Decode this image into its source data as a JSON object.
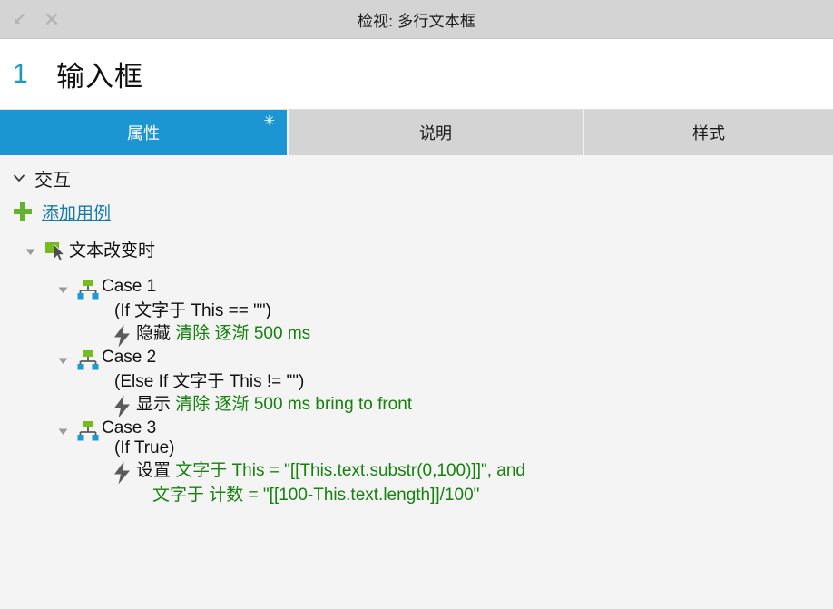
{
  "titlebar": {
    "title": "检视: 多行文本框",
    "buttons": [
      {
        "name": "collapse-icon",
        "label": "collapse"
      },
      {
        "name": "close-icon",
        "label": "close"
      }
    ]
  },
  "widget": {
    "index": "1",
    "name": "输入框"
  },
  "tabs": [
    {
      "label": "属性",
      "active": true,
      "badge": "✳"
    },
    {
      "label": "说明",
      "active": false,
      "badge": ""
    },
    {
      "label": "样式",
      "active": false,
      "badge": ""
    }
  ],
  "section": {
    "caret": "chevron-down",
    "title": "交互",
    "add_case_label": "添加用例"
  },
  "event": {
    "caret": "triangle-down",
    "icon": "mouse-cursor-icon",
    "label": "文本改变时"
  },
  "cases": [
    {
      "caret": "triangle-down",
      "icon": "case-branch-icon",
      "title": "Case 1",
      "condition": "(If 文字于 This == \"\")",
      "actions": [
        {
          "icon": "lightning-bolt-icon",
          "lines": [
            [
              {
                "text": "隐藏 ",
                "color": "black"
              },
              {
                "text": "清除 逐渐 500 ms",
                "color": "green"
              }
            ]
          ]
        }
      ]
    },
    {
      "caret": "triangle-down",
      "icon": "case-branch-icon",
      "title": "Case 2",
      "condition": "(Else If 文字于 This != \"\")",
      "actions": [
        {
          "icon": "lightning-bolt-icon",
          "lines": [
            [
              {
                "text": "显示 ",
                "color": "black"
              },
              {
                "text": "清除 逐渐 500 ms bring to front",
                "color": "green"
              }
            ]
          ]
        }
      ]
    },
    {
      "caret": "triangle-down",
      "icon": "case-branch-icon",
      "title": "Case 3",
      "condition": "(If True)",
      "actions": [
        {
          "icon": "lightning-bolt-icon",
          "lines": [
            [
              {
                "text": "设置 ",
                "color": "black"
              },
              {
                "text": "文字于 This = \"[[This.text.substr(0,100)]]\", and",
                "color": "green"
              }
            ],
            [
              {
                "text": "文字于 计数 = \"[[100-This.text.length]]/100\"",
                "color": "green"
              }
            ]
          ]
        }
      ]
    }
  ],
  "colors": {
    "tab_active": "#1b96d3",
    "link": "#1679a8",
    "green_text": "#17800f",
    "green_icon": "#76bc21",
    "blue_icon": "#1b9ad6",
    "index_blue": "#2196c4",
    "titlebar_bg": "#d4d4d4",
    "content_bg": "#f4f4f4"
  }
}
